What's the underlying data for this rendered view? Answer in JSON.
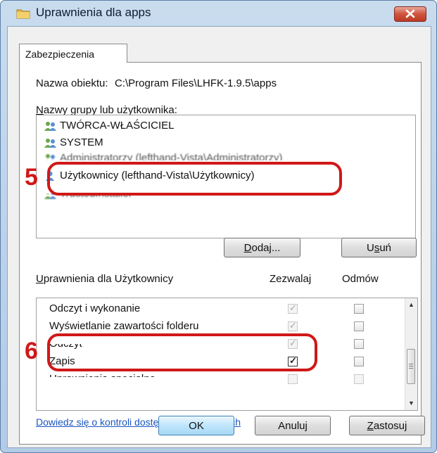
{
  "window": {
    "title": "Uprawnienia dla apps",
    "icon": "folder-icon",
    "close_icon": "close-icon"
  },
  "tabs": [
    {
      "label": "Zabezpieczenia",
      "selected": true
    }
  ],
  "object_name": {
    "label": "Nazwa obiektu:",
    "value": "C:\\Program Files\\LHFK-1.9.5\\apps"
  },
  "groups": {
    "label_prefix": "N",
    "label_rest": "azwy grupy lub użytkownika:",
    "items": [
      {
        "name": "TWÓRCA-WŁAŚCICIEL",
        "icon": "users-icon"
      },
      {
        "name": "SYSTEM",
        "icon": "users-icon"
      },
      {
        "name": "Administratorzy (lefthand-Vista\\Administratorzy)",
        "icon": "users-icon"
      },
      {
        "name": "Użytkownicy (lefthand-Vista\\Użytkownicy)",
        "icon": "user-icon",
        "selected": true
      },
      {
        "name": "TrustedInstaller",
        "icon": "users-icon"
      }
    ]
  },
  "group_buttons": {
    "add_prefix": "D",
    "add_rest": "odaj...",
    "remove_pre": "U",
    "remove_ul": "s",
    "remove_post": "uń"
  },
  "permissions": {
    "header_prefix": "U",
    "header_rest": "prawnienia dla Użytkownicy",
    "allow_header": "Zezwalaj",
    "deny_header": "Odmów",
    "rows": [
      {
        "name": "Odczyt i wykonanie",
        "allow": true,
        "deny": false
      },
      {
        "name": "Wyświetlanie zawartości folderu",
        "allow": true,
        "deny": false
      },
      {
        "name": "Odczyt",
        "allow": true,
        "deny": false
      },
      {
        "name": "Zapis",
        "allow": true,
        "deny": false,
        "editable": true
      },
      {
        "name": "Uprawnienia specjalne",
        "allow": false,
        "deny": false
      }
    ]
  },
  "help_link": "Dowiedz się o kontroli dostępu i uprawnieniach",
  "dialog_buttons": {
    "ok": "OK",
    "cancel": "Anuluj",
    "apply_prefix": "Z",
    "apply_rest": "astosuj"
  },
  "annotations": [
    {
      "number": "5",
      "color": "#d01818"
    },
    {
      "number": "6",
      "color": "#d01818"
    }
  ]
}
